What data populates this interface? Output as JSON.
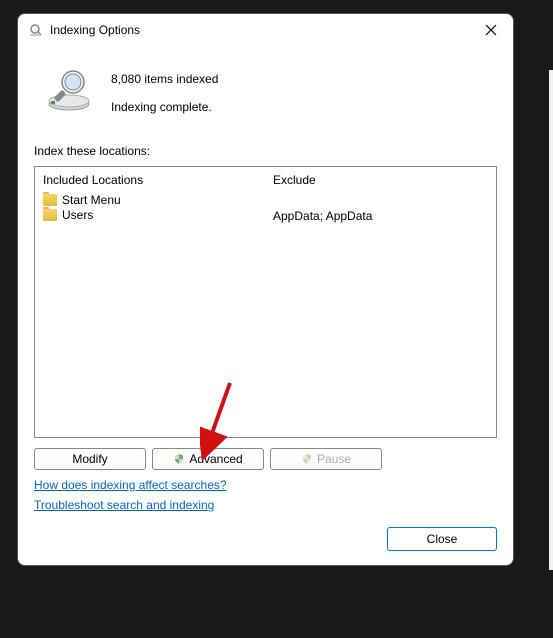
{
  "titlebar": {
    "title": "Indexing Options"
  },
  "info": {
    "items_indexed": "8,080 items indexed",
    "status": "Indexing complete."
  },
  "section_label": "Index these locations:",
  "columns": {
    "included_header": "Included Locations",
    "exclude_header": "Exclude"
  },
  "locations": [
    {
      "name": "Start Menu",
      "exclude": ""
    },
    {
      "name": "Users",
      "exclude": "AppData; AppData"
    }
  ],
  "buttons": {
    "modify": "Modify",
    "advanced": "Advanced",
    "pause": "Pause",
    "close": "Close"
  },
  "links": {
    "affect": "How does indexing affect searches?",
    "troubleshoot": "Troubleshoot search and indexing"
  }
}
